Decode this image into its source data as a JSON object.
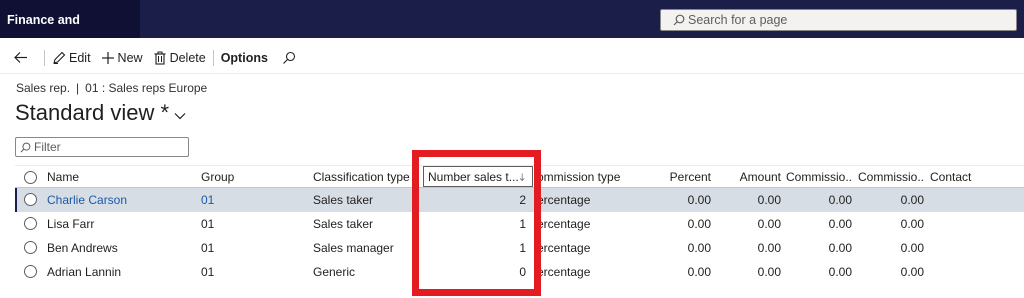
{
  "app": {
    "title": "Finance and Operations"
  },
  "search": {
    "placeholder": "Search for a page"
  },
  "actions": {
    "edit": "Edit",
    "new": "New",
    "delete": "Delete",
    "options": "Options"
  },
  "breadcrumb": {
    "entity": "Sales rep.",
    "separator": "|",
    "record": "01 : Sales reps Europe"
  },
  "view": {
    "title": "Standard view *"
  },
  "filter": {
    "placeholder": "Filter"
  },
  "columns": {
    "name": "Name",
    "group": "Group",
    "classification_type": "Classification type",
    "number_sales_takers": "Number sales t...",
    "commission_type": "ommission type",
    "percent": "Percent",
    "amount": "Amount",
    "commission1": "Commissio...",
    "commission2": "Commissio...",
    "contact": "Contact"
  },
  "rows": [
    {
      "name": "Charlie Carson",
      "group": "01",
      "classification_type": "Sales taker",
      "number_sales_takers": "2",
      "commission_type": "ercentage",
      "percent": "0.00",
      "amount": "0.00",
      "commission1": "0.00",
      "commission2": "0.00",
      "contact": ""
    },
    {
      "name": "Lisa Farr",
      "group": "01",
      "classification_type": "Sales taker",
      "number_sales_takers": "1",
      "commission_type": "ercentage",
      "percent": "0.00",
      "amount": "0.00",
      "commission1": "0.00",
      "commission2": "0.00",
      "contact": ""
    },
    {
      "name": "Ben Andrews",
      "group": "01",
      "classification_type": "Sales manager",
      "number_sales_takers": "1",
      "commission_type": "ercentage",
      "percent": "0.00",
      "amount": "0.00",
      "commission1": "0.00",
      "commission2": "0.00",
      "contact": ""
    },
    {
      "name": "Adrian Lannin",
      "group": "01",
      "classification_type": "Generic",
      "number_sales_takers": "0",
      "commission_type": "ercentage",
      "percent": "0.00",
      "amount": "0.00",
      "commission1": "0.00",
      "commission2": "0.00",
      "contact": ""
    }
  ],
  "colors": {
    "topbar": "#1b1e48",
    "title_block": "#0f1033",
    "link": "#1a5aa6",
    "selected_row": "#d7dde4",
    "highlight": "#e31b23"
  },
  "icons": [
    "search-icon",
    "back-arrow-icon",
    "edit-pencil-icon",
    "plus-icon",
    "trash-icon",
    "chevron-down-icon",
    "sort-descending-icon",
    "filter-search-icon"
  ]
}
